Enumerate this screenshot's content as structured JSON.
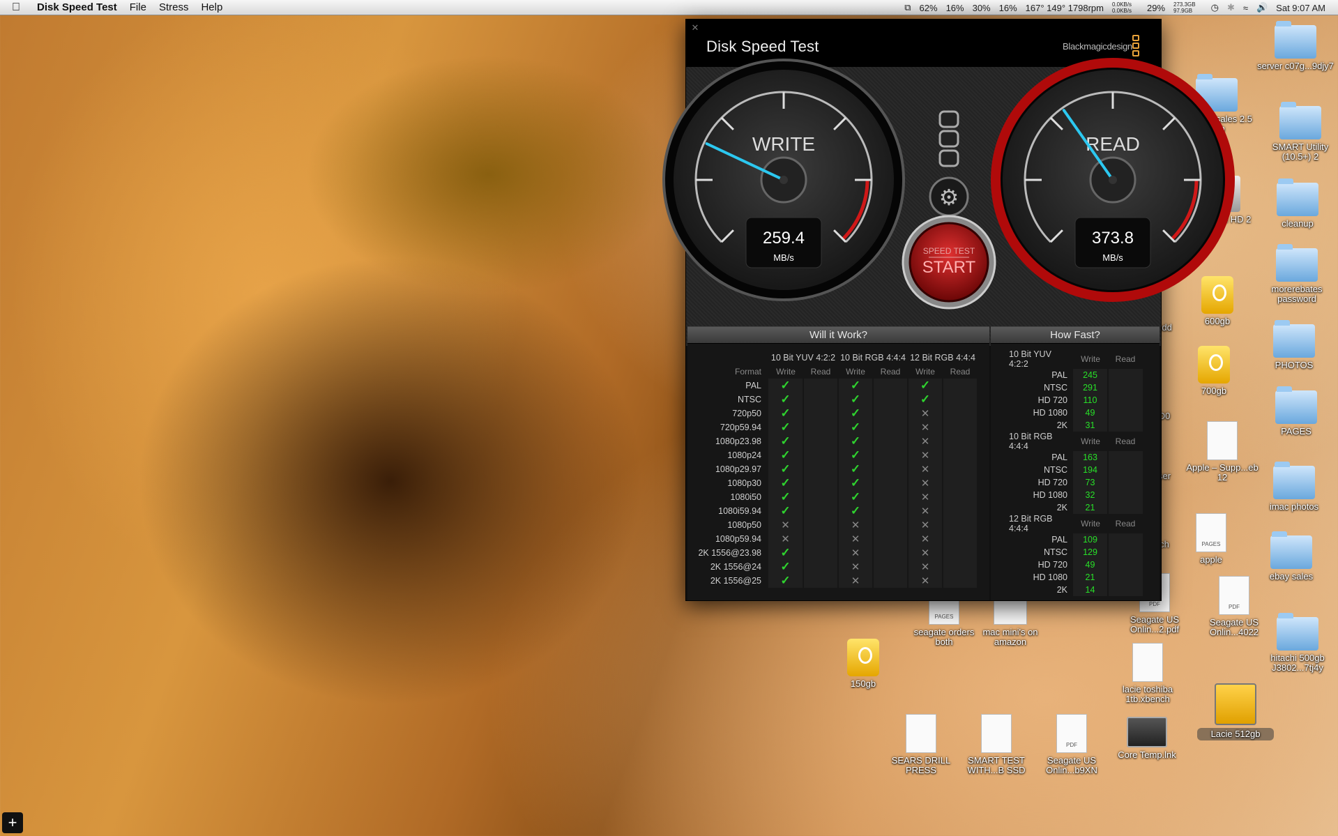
{
  "menubar": {
    "app_name": "Disk Speed Test",
    "items": [
      "File",
      "Stress",
      "Help"
    ],
    "status": {
      "battery": "62%",
      "cpu1": "16%",
      "cpu2": "30%",
      "cpu3": "16%",
      "temps": "167° 149° 1798rpm",
      "net_up": "0.0KB/s",
      "net_down": "0.0KB/s",
      "mem": "29%",
      "disk_used": "273.3GB",
      "disk_free": "97.9GB",
      "clock": "Sat 9:07 AM"
    }
  },
  "window": {
    "title": "Disk Speed Test",
    "brand": "Blackmagicdesign",
    "write_gauge": {
      "label": "WRITE",
      "value": "259.4",
      "unit": "MB/s",
      "fraction": 0.26
    },
    "read_gauge": {
      "label": "READ",
      "value": "373.8",
      "unit": "MB/s",
      "fraction": 0.37
    },
    "start_button": {
      "top": "SPEED TEST",
      "main": "START"
    },
    "will_it_work": {
      "title": "Will it Work?",
      "groups": [
        "10 Bit YUV 4:2:2",
        "10 Bit RGB 4:4:4",
        "12 Bit RGB 4:4:4"
      ],
      "format_header": "Format",
      "write_label": "Write",
      "read_label": "Read",
      "rows": [
        {
          "format": "PAL",
          "w": [
            true,
            true,
            true
          ]
        },
        {
          "format": "NTSC",
          "w": [
            true,
            true,
            true
          ]
        },
        {
          "format": "720p50",
          "w": [
            true,
            true,
            false
          ]
        },
        {
          "format": "720p59.94",
          "w": [
            true,
            true,
            false
          ]
        },
        {
          "format": "1080p23.98",
          "w": [
            true,
            true,
            false
          ]
        },
        {
          "format": "1080p24",
          "w": [
            true,
            true,
            false
          ]
        },
        {
          "format": "1080p29.97",
          "w": [
            true,
            true,
            false
          ]
        },
        {
          "format": "1080p30",
          "w": [
            true,
            true,
            false
          ]
        },
        {
          "format": "1080i50",
          "w": [
            true,
            true,
            false
          ]
        },
        {
          "format": "1080i59.94",
          "w": [
            true,
            true,
            false
          ]
        },
        {
          "format": "1080p50",
          "w": [
            false,
            false,
            false
          ]
        },
        {
          "format": "1080p59.94",
          "w": [
            false,
            false,
            false
          ]
        },
        {
          "format": "2K 1556@23.98",
          "w": [
            true,
            false,
            false
          ]
        },
        {
          "format": "2K 1556@24",
          "w": [
            true,
            false,
            false
          ]
        },
        {
          "format": "2K 1556@25",
          "w": [
            true,
            false,
            false
          ]
        }
      ]
    },
    "how_fast": {
      "title": "How Fast?",
      "write_label": "Write",
      "read_label": "Read",
      "sections": [
        {
          "name": "10 Bit YUV 4:2:2",
          "rows": [
            [
              "PAL",
              "245"
            ],
            [
              "NTSC",
              "291"
            ],
            [
              "HD 720",
              "110"
            ],
            [
              "HD 1080",
              "49"
            ],
            [
              "2K",
              "31"
            ]
          ]
        },
        {
          "name": "10 Bit RGB 4:4:4",
          "rows": [
            [
              "PAL",
              "163"
            ],
            [
              "NTSC",
              "194"
            ],
            [
              "HD 720",
              "73"
            ],
            [
              "HD 1080",
              "32"
            ],
            [
              "2K",
              "21"
            ]
          ]
        },
        {
          "name": "12 Bit RGB 4:4:4",
          "rows": [
            [
              "PAL",
              "109"
            ],
            [
              "NTSC",
              "129"
            ],
            [
              "HD 720",
              "49"
            ],
            [
              "HD 1080",
              "21"
            ],
            [
              "2K",
              "14"
            ]
          ]
        }
      ]
    }
  },
  "desktop_icons": {
    "server": "server c07g...9djy7",
    "seagate_sales": "seagate sales 2.5 inch",
    "smart_utility": "SMART Utility (10.5+) 2",
    "macintosh_hd": "...intosh HD 2",
    "cleanup": "cleanup",
    "morerebates": "morerebates password",
    "drive_600": "600gb",
    "photos": "PHOTOS",
    "drive_700": "700gb",
    "pages": "PAGES",
    "apple_supp": "Apple – Supp...eb 12",
    "imac_photos": "imac photos",
    "apple": "apple",
    "ebay_sales": "ebay sales",
    "seagate_us_2": "Seagate US Onlin...2.pdf",
    "seagate_us_4022": "Seagate US Onlin...4022",
    "hitachi": "hitachi 500gb J3802...7tj4y",
    "seagate_orders": "seagate orders both",
    "mac_mini": "mac mini's on amazon",
    "drive_150": "150gb",
    "lacie_xbench": "lacie toshiba 1tb.xbench",
    "lacie_512": "Lacie 512gb",
    "sears": "SEARS DRILL PRESS",
    "smart_test": "SMART TEST WITH...B SSD",
    "seagate_b9xn": "Seagate US Onlin...b9XN",
    "core_temp": "Core Temp.lnk",
    "cns_partial": "cns",
    "ndd_partial": "ndd",
    "d0_partial": "D0",
    "ser_partial": "ser",
    "ch_partial": "ch"
  }
}
